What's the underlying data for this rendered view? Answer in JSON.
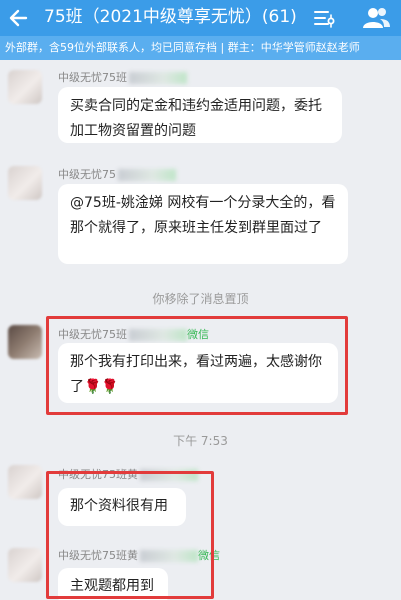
{
  "header": {
    "title": "75班（2021中级尊享无忧）(61)"
  },
  "notice": "外部群，含59位外部联系人，均已同意存档 | 群主：中华学管师赵赵老师",
  "messages": [
    {
      "sender": "中级无忧75班",
      "sender_tag": "",
      "text": "买卖合同的定金和违约金适用问题，委托加工物资留置的问题"
    },
    {
      "sender": "中级无忧75",
      "sender_tag": "",
      "text": "@75班-姚淦娣 网校有一个分录大全的，看那个就得了，原来班主任发到群里面过了"
    },
    {
      "sender": "中级无忧75班",
      "sender_tag": "微信",
      "text": "那个我有打印出来，看过两遍，太感谢你了🌹🌹"
    },
    {
      "sender": "中级无忧75班黄",
      "sender_tag": "",
      "text": "那个资料很有用"
    },
    {
      "sender": "中级无忧75班黄",
      "sender_tag": "微信",
      "text": "主观题都用到"
    }
  ],
  "system": {
    "pin_removed": "你移除了消息置顶",
    "time": "下午 7:53"
  },
  "colors": {
    "header_bg": "#3b9ce8",
    "highlight": "#e23b3b"
  },
  "icons": {
    "back": "back-arrow-icon",
    "list": "list-settings-icon",
    "members": "group-members-icon"
  }
}
